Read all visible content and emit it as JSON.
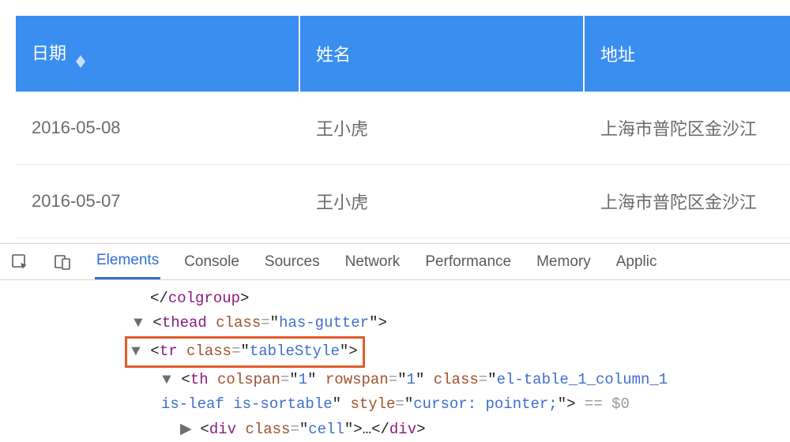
{
  "table": {
    "headers": {
      "date": "日期",
      "name": "姓名",
      "address": "地址"
    },
    "rows": [
      {
        "date": "2016-05-08",
        "name": "王小虎",
        "address": "上海市普陀区金沙江"
      },
      {
        "date": "2016-05-07",
        "name": "王小虎",
        "address": "上海市普陀区金沙江"
      }
    ]
  },
  "devtools": {
    "tabs": {
      "elements": "Elements",
      "console": "Console",
      "sources": "Sources",
      "network": "Network",
      "performance": "Performance",
      "memory": "Memory",
      "application": "Applic"
    },
    "dom": {
      "line0_closetag": "colgroup",
      "thead_tag": "thead",
      "thead_class_attr": "class",
      "thead_class_val": "has-gutter",
      "tr_tag": "tr",
      "tr_class_attr": "class",
      "tr_class_val": "tableStyle",
      "th_tag": "th",
      "th_colspan_attr": "colspan",
      "th_colspan_val": "1",
      "th_rowspan_attr": "rowspan",
      "th_rowspan_val": "1",
      "th_class_attr": "class",
      "th_class_val1": "el-table_1_column_1",
      "th_class_val2": "is-leaf is-sortable",
      "th_style_attr": "style",
      "th_style_val": "cursor: pointer;",
      "selected_suffix": " == $0",
      "div_tag": "div",
      "div_class_attr": "class",
      "div_class_val": "cell",
      "ellipsis": "…"
    }
  }
}
